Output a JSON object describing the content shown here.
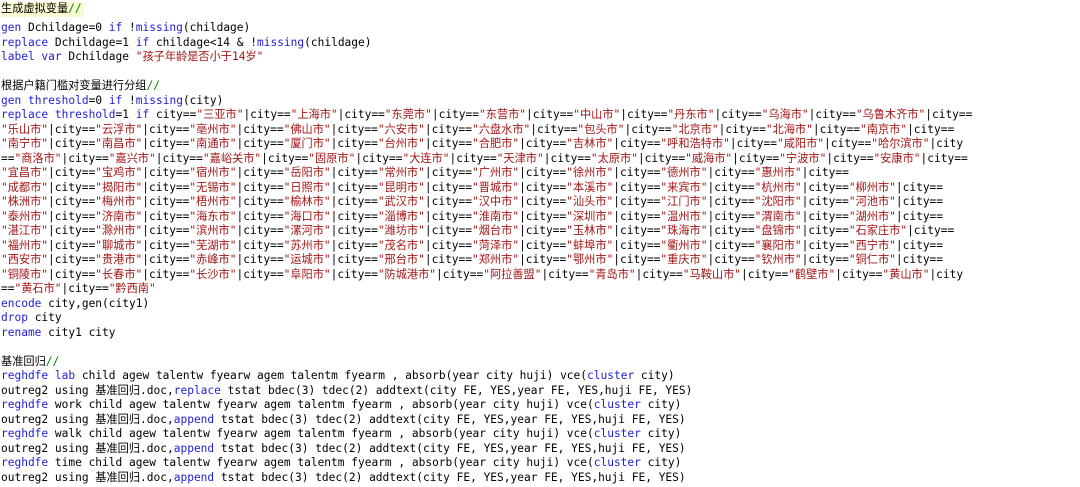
{
  "colors": {
    "keyword": "#1f1fd6",
    "string": "#a31515",
    "comment": "#008000",
    "text": "#000000",
    "current_line": "#fafad2"
  },
  "lines": [
    [
      {
        "t": "zh",
        "v": "生成虚拟变量"
      },
      {
        "t": "cmt",
        "v": "//"
      }
    ],
    [
      {
        "t": "kw",
        "v": "gen"
      },
      {
        "t": "n",
        "v": " Dchildage=0 "
      },
      {
        "t": "kw",
        "v": "if"
      },
      {
        "t": "n",
        "v": " !"
      },
      {
        "t": "kw",
        "v": "missing"
      },
      {
        "t": "n",
        "v": "(childage)"
      }
    ],
    [
      {
        "t": "kw",
        "v": "replace"
      },
      {
        "t": "n",
        "v": " Dchildage=1 "
      },
      {
        "t": "kw",
        "v": "if"
      },
      {
        "t": "n",
        "v": " childage<14 & !"
      },
      {
        "t": "kw",
        "v": "missing"
      },
      {
        "t": "n",
        "v": "(childage)"
      }
    ],
    [
      {
        "t": "kw",
        "v": "label var"
      },
      {
        "t": "n",
        "v": " Dchildage "
      },
      {
        "t": "str",
        "v": "\"孩子年龄是否小于14岁\""
      }
    ],
    [],
    [
      {
        "t": "zh",
        "v": "根据户籍门槛对变量进行分组"
      },
      {
        "t": "cmt",
        "v": "//"
      }
    ],
    [
      {
        "t": "kw",
        "v": "gen"
      },
      {
        "t": "n",
        "v": " "
      },
      {
        "t": "kw",
        "v": "threshold"
      },
      {
        "t": "n",
        "v": "=0 "
      },
      {
        "t": "kw",
        "v": "if"
      },
      {
        "t": "n",
        "v": " !"
      },
      {
        "t": "kw",
        "v": "missing"
      },
      {
        "t": "n",
        "v": "(city)"
      }
    ],
    [
      {
        "t": "kw",
        "v": "replace"
      },
      {
        "t": "n",
        "v": " "
      },
      {
        "t": "kw",
        "v": "threshold"
      },
      {
        "t": "n",
        "v": "=1 "
      },
      {
        "t": "kw",
        "v": "if"
      },
      {
        "t": "n",
        "v": " city=="
      },
      {
        "t": "str",
        "v": "\"三亚市\""
      },
      {
        "t": "n",
        "v": "|city=="
      },
      {
        "t": "str",
        "v": "\"上海市\""
      },
      {
        "t": "n",
        "v": "|city=="
      },
      {
        "t": "str",
        "v": "\"东莞市\""
      },
      {
        "t": "n",
        "v": "|city=="
      },
      {
        "t": "str",
        "v": "\"东营市\""
      },
      {
        "t": "n",
        "v": "|city=="
      },
      {
        "t": "str",
        "v": "\"中山市\""
      },
      {
        "t": "n",
        "v": "|city=="
      },
      {
        "t": "str",
        "v": "\"丹东市\""
      },
      {
        "t": "n",
        "v": "|city=="
      },
      {
        "t": "str",
        "v": "\"乌海市\""
      },
      {
        "t": "n",
        "v": "|city=="
      },
      {
        "t": "str",
        "v": "\"乌鲁木齐市\""
      },
      {
        "t": "n",
        "v": "|city=="
      }
    ],
    [
      {
        "t": "str",
        "v": "\"乐山市\""
      },
      {
        "t": "n",
        "v": "|city=="
      },
      {
        "t": "str",
        "v": "\"云浮市\""
      },
      {
        "t": "n",
        "v": "|city=="
      },
      {
        "t": "str",
        "v": "\"亳州市\""
      },
      {
        "t": "n",
        "v": "|city=="
      },
      {
        "t": "str",
        "v": "\"佛山市\""
      },
      {
        "t": "n",
        "v": "|city=="
      },
      {
        "t": "str",
        "v": "\"六安市\""
      },
      {
        "t": "n",
        "v": "|city=="
      },
      {
        "t": "str",
        "v": "\"六盘水市\""
      },
      {
        "t": "n",
        "v": "|city=="
      },
      {
        "t": "str",
        "v": "\"包头市\""
      },
      {
        "t": "n",
        "v": "|city=="
      },
      {
        "t": "str",
        "v": "\"北京市\""
      },
      {
        "t": "n",
        "v": "|city=="
      },
      {
        "t": "str",
        "v": "\"北海市\""
      },
      {
        "t": "n",
        "v": "|city=="
      },
      {
        "t": "str",
        "v": "\"南京市\""
      },
      {
        "t": "n",
        "v": "|city=="
      }
    ],
    [
      {
        "t": "str",
        "v": "\"南宁市\""
      },
      {
        "t": "n",
        "v": "|city=="
      },
      {
        "t": "str",
        "v": "\"南昌市\""
      },
      {
        "t": "n",
        "v": "|city=="
      },
      {
        "t": "str",
        "v": "\"南通市\""
      },
      {
        "t": "n",
        "v": "|city=="
      },
      {
        "t": "str",
        "v": "\"厦门市\""
      },
      {
        "t": "n",
        "v": "|city=="
      },
      {
        "t": "str",
        "v": "\"台州市\""
      },
      {
        "t": "n",
        "v": "|city=="
      },
      {
        "t": "str",
        "v": "\"合肥市\""
      },
      {
        "t": "n",
        "v": "|city=="
      },
      {
        "t": "str",
        "v": "\"吉林市\""
      },
      {
        "t": "n",
        "v": "|city=="
      },
      {
        "t": "str",
        "v": "\"呼和浩特市\""
      },
      {
        "t": "n",
        "v": "|city=="
      },
      {
        "t": "str",
        "v": "\"咸阳市\""
      },
      {
        "t": "n",
        "v": "|city=="
      },
      {
        "t": "str",
        "v": "\"哈尔滨市\""
      },
      {
        "t": "n",
        "v": "|city"
      }
    ],
    [
      {
        "t": "n",
        "v": "=="
      },
      {
        "t": "str",
        "v": "\"商洛市\""
      },
      {
        "t": "n",
        "v": "|city=="
      },
      {
        "t": "str",
        "v": "\"嘉兴市\""
      },
      {
        "t": "n",
        "v": "|city=="
      },
      {
        "t": "str",
        "v": "\"嘉峪关市\""
      },
      {
        "t": "n",
        "v": "|city=="
      },
      {
        "t": "str",
        "v": "\"固原市\""
      },
      {
        "t": "n",
        "v": "|city=="
      },
      {
        "t": "str",
        "v": "\"大连市\""
      },
      {
        "t": "n",
        "v": "|city=="
      },
      {
        "t": "str",
        "v": "\"天津市\""
      },
      {
        "t": "n",
        "v": "|city=="
      },
      {
        "t": "str",
        "v": "\"太原市\""
      },
      {
        "t": "n",
        "v": "|city=="
      },
      {
        "t": "str",
        "v": "\"威海市\""
      },
      {
        "t": "n",
        "v": "|city=="
      },
      {
        "t": "str",
        "v": "\"宁波市\""
      },
      {
        "t": "n",
        "v": "|city=="
      },
      {
        "t": "str",
        "v": "\"安康市\""
      },
      {
        "t": "n",
        "v": "|city=="
      }
    ],
    [
      {
        "t": "str",
        "v": "\"宜昌市\""
      },
      {
        "t": "n",
        "v": "|city=="
      },
      {
        "t": "str",
        "v": "\"宝鸡市\""
      },
      {
        "t": "n",
        "v": "|city=="
      },
      {
        "t": "str",
        "v": "\"宿州市\""
      },
      {
        "t": "n",
        "v": "|city=="
      },
      {
        "t": "str",
        "v": "\"岳阳市\""
      },
      {
        "t": "n",
        "v": "|city=="
      },
      {
        "t": "str",
        "v": "\"常州市\""
      },
      {
        "t": "n",
        "v": "|city=="
      },
      {
        "t": "str",
        "v": "\"广州市\""
      },
      {
        "t": "n",
        "v": "|city=="
      },
      {
        "t": "str",
        "v": "\"徐州市\""
      },
      {
        "t": "n",
        "v": "|city=="
      },
      {
        "t": "str",
        "v": "\"德州市\""
      },
      {
        "t": "n",
        "v": "|city=="
      },
      {
        "t": "str",
        "v": "\"惠州市\""
      },
      {
        "t": "n",
        "v": "|city=="
      }
    ],
    [
      {
        "t": "str",
        "v": "\"成都市\""
      },
      {
        "t": "n",
        "v": "|city=="
      },
      {
        "t": "str",
        "v": "\"揭阳市\""
      },
      {
        "t": "n",
        "v": "|city=="
      },
      {
        "t": "str",
        "v": "\"无锡市\""
      },
      {
        "t": "n",
        "v": "|city=="
      },
      {
        "t": "str",
        "v": "\"日照市\""
      },
      {
        "t": "n",
        "v": "|city=="
      },
      {
        "t": "str",
        "v": "\"昆明市\""
      },
      {
        "t": "n",
        "v": "|city=="
      },
      {
        "t": "str",
        "v": "\"晋城市\""
      },
      {
        "t": "n",
        "v": "|city=="
      },
      {
        "t": "str",
        "v": "\"本溪市\""
      },
      {
        "t": "n",
        "v": "|city=="
      },
      {
        "t": "str",
        "v": "\"来宾市\""
      },
      {
        "t": "n",
        "v": "|city=="
      },
      {
        "t": "str",
        "v": "\"杭州市\""
      },
      {
        "t": "n",
        "v": "|city=="
      },
      {
        "t": "str",
        "v": "\"柳州市\""
      },
      {
        "t": "n",
        "v": "|city=="
      }
    ],
    [
      {
        "t": "str",
        "v": "\"株洲市\""
      },
      {
        "t": "n",
        "v": "|city=="
      },
      {
        "t": "str",
        "v": "\"梅州市\""
      },
      {
        "t": "n",
        "v": "|city=="
      },
      {
        "t": "str",
        "v": "\"梧州市\""
      },
      {
        "t": "n",
        "v": "|city=="
      },
      {
        "t": "str",
        "v": "\"榆林市\""
      },
      {
        "t": "n",
        "v": "|city=="
      },
      {
        "t": "str",
        "v": "\"武汉市\""
      },
      {
        "t": "n",
        "v": "|city=="
      },
      {
        "t": "str",
        "v": "\"汉中市\""
      },
      {
        "t": "n",
        "v": "|city=="
      },
      {
        "t": "str",
        "v": "\"汕头市\""
      },
      {
        "t": "n",
        "v": "|city=="
      },
      {
        "t": "str",
        "v": "\"江门市\""
      },
      {
        "t": "n",
        "v": "|city=="
      },
      {
        "t": "str",
        "v": "\"沈阳市\""
      },
      {
        "t": "n",
        "v": "|city=="
      },
      {
        "t": "str",
        "v": "\"河池市\""
      },
      {
        "t": "n",
        "v": "|city=="
      }
    ],
    [
      {
        "t": "str",
        "v": "\"泰州市\""
      },
      {
        "t": "n",
        "v": "|city=="
      },
      {
        "t": "str",
        "v": "\"济南市\""
      },
      {
        "t": "n",
        "v": "|city=="
      },
      {
        "t": "str",
        "v": "\"海东市\""
      },
      {
        "t": "n",
        "v": "|city=="
      },
      {
        "t": "str",
        "v": "\"海口市\""
      },
      {
        "t": "n",
        "v": "|city=="
      },
      {
        "t": "str",
        "v": "\"淄博市\""
      },
      {
        "t": "n",
        "v": "|city=="
      },
      {
        "t": "str",
        "v": "\"淮南市\""
      },
      {
        "t": "n",
        "v": "|city=="
      },
      {
        "t": "str",
        "v": "\"深圳市\""
      },
      {
        "t": "n",
        "v": "|city=="
      },
      {
        "t": "str",
        "v": "\"温州市\""
      },
      {
        "t": "n",
        "v": "|city=="
      },
      {
        "t": "str",
        "v": "\"渭南市\""
      },
      {
        "t": "n",
        "v": "|city=="
      },
      {
        "t": "str",
        "v": "\"湖州市\""
      },
      {
        "t": "n",
        "v": "|city=="
      }
    ],
    [
      {
        "t": "str",
        "v": "\"湛江市\""
      },
      {
        "t": "n",
        "v": "|city=="
      },
      {
        "t": "str",
        "v": "\"滁州市\""
      },
      {
        "t": "n",
        "v": "|city=="
      },
      {
        "t": "str",
        "v": "\"滨州市\""
      },
      {
        "t": "n",
        "v": "|city=="
      },
      {
        "t": "str",
        "v": "\"漯河市\""
      },
      {
        "t": "n",
        "v": "|city=="
      },
      {
        "t": "str",
        "v": "\"潍坊市\""
      },
      {
        "t": "n",
        "v": "|city=="
      },
      {
        "t": "str",
        "v": "\"烟台市\""
      },
      {
        "t": "n",
        "v": "|city=="
      },
      {
        "t": "str",
        "v": "\"玉林市\""
      },
      {
        "t": "n",
        "v": "|city=="
      },
      {
        "t": "str",
        "v": "\"珠海市\""
      },
      {
        "t": "n",
        "v": "|city=="
      },
      {
        "t": "str",
        "v": "\"盘锦市\""
      },
      {
        "t": "n",
        "v": "|city=="
      },
      {
        "t": "str",
        "v": "\"石家庄市\""
      },
      {
        "t": "n",
        "v": "|city=="
      }
    ],
    [
      {
        "t": "str",
        "v": "\"福州市\""
      },
      {
        "t": "n",
        "v": "|city=="
      },
      {
        "t": "str",
        "v": "\"聊城市\""
      },
      {
        "t": "n",
        "v": "|city=="
      },
      {
        "t": "str",
        "v": "\"芜湖市\""
      },
      {
        "t": "n",
        "v": "|city=="
      },
      {
        "t": "str",
        "v": "\"苏州市\""
      },
      {
        "t": "n",
        "v": "|city=="
      },
      {
        "t": "str",
        "v": "\"茂名市\""
      },
      {
        "t": "n",
        "v": "|city=="
      },
      {
        "t": "str",
        "v": "\"菏泽市\""
      },
      {
        "t": "n",
        "v": "|city=="
      },
      {
        "t": "str",
        "v": "\"蚌埠市\""
      },
      {
        "t": "n",
        "v": "|city=="
      },
      {
        "t": "str",
        "v": "\"衢州市\""
      },
      {
        "t": "n",
        "v": "|city=="
      },
      {
        "t": "str",
        "v": "\"襄阳市\""
      },
      {
        "t": "n",
        "v": "|city=="
      },
      {
        "t": "str",
        "v": "\"西宁市\""
      },
      {
        "t": "n",
        "v": "|city=="
      }
    ],
    [
      {
        "t": "str",
        "v": "\"西安市\""
      },
      {
        "t": "n",
        "v": "|city=="
      },
      {
        "t": "str",
        "v": "\"贵港市\""
      },
      {
        "t": "n",
        "v": "|city=="
      },
      {
        "t": "str",
        "v": "\"赤峰市\""
      },
      {
        "t": "n",
        "v": "|city=="
      },
      {
        "t": "str",
        "v": "\"运城市\""
      },
      {
        "t": "n",
        "v": "|city=="
      },
      {
        "t": "str",
        "v": "\"邢台市\""
      },
      {
        "t": "n",
        "v": "|city=="
      },
      {
        "t": "str",
        "v": "\"郑州市\""
      },
      {
        "t": "n",
        "v": "|city=="
      },
      {
        "t": "str",
        "v": "\"鄂州市\""
      },
      {
        "t": "n",
        "v": "|city=="
      },
      {
        "t": "str",
        "v": "\"重庆市\""
      },
      {
        "t": "n",
        "v": "|city=="
      },
      {
        "t": "str",
        "v": "\"钦州市\""
      },
      {
        "t": "n",
        "v": "|city=="
      },
      {
        "t": "str",
        "v": "\"铜仁市\""
      },
      {
        "t": "n",
        "v": "|city=="
      }
    ],
    [
      {
        "t": "str",
        "v": "\"铜陵市\""
      },
      {
        "t": "n",
        "v": "|city=="
      },
      {
        "t": "str",
        "v": "\"长春市\""
      },
      {
        "t": "n",
        "v": "|city=="
      },
      {
        "t": "str",
        "v": "\"长沙市\""
      },
      {
        "t": "n",
        "v": "|city=="
      },
      {
        "t": "str",
        "v": "\"阜阳市\""
      },
      {
        "t": "n",
        "v": "|city=="
      },
      {
        "t": "str",
        "v": "\"防城港市\""
      },
      {
        "t": "n",
        "v": "|city=="
      },
      {
        "t": "str",
        "v": "\"阿拉善盟\""
      },
      {
        "t": "n",
        "v": "|city=="
      },
      {
        "t": "str",
        "v": "\"青岛市\""
      },
      {
        "t": "n",
        "v": "|city=="
      },
      {
        "t": "str",
        "v": "\"马鞍山市\""
      },
      {
        "t": "n",
        "v": "|city=="
      },
      {
        "t": "str",
        "v": "\"鹤壁市\""
      },
      {
        "t": "n",
        "v": "|city=="
      },
      {
        "t": "str",
        "v": "\"黄山市\""
      },
      {
        "t": "n",
        "v": "|city"
      }
    ],
    [
      {
        "t": "n",
        "v": "=="
      },
      {
        "t": "str",
        "v": "\"黄石市\""
      },
      {
        "t": "n",
        "v": "|city=="
      },
      {
        "t": "str",
        "v": "\"黔西南\""
      }
    ],
    [
      {
        "t": "kw",
        "v": "encode"
      },
      {
        "t": "n",
        "v": " city,gen(city1)"
      }
    ],
    [
      {
        "t": "kw",
        "v": "drop"
      },
      {
        "t": "n",
        "v": " city"
      }
    ],
    [
      {
        "t": "kw",
        "v": "rename"
      },
      {
        "t": "n",
        "v": " city1 city"
      }
    ],
    [],
    [
      {
        "t": "zh",
        "v": "基准回归"
      },
      {
        "t": "cmt",
        "v": "//"
      }
    ],
    [
      {
        "t": "kw",
        "v": "reghdfe"
      },
      {
        "t": "n",
        "v": " "
      },
      {
        "t": "kw",
        "v": "lab"
      },
      {
        "t": "n",
        "v": " child agew talentw fyearw agem talentm fyearm , absorb(year city huji) vce("
      },
      {
        "t": "kw",
        "v": "cluster"
      },
      {
        "t": "n",
        "v": " city)"
      }
    ],
    [
      {
        "t": "n",
        "v": "outreg2 using 基准回归.doc,"
      },
      {
        "t": "kw",
        "v": "replace"
      },
      {
        "t": "n",
        "v": " tstat bdec(3) tdec(2) addtext(city FE, YES,year FE, YES,huji FE, YES)"
      }
    ],
    [
      {
        "t": "kw",
        "v": "reghdfe"
      },
      {
        "t": "n",
        "v": " work child agew talentw fyearw agem talentm fyearm , absorb(year city huji) vce("
      },
      {
        "t": "kw",
        "v": "cluster"
      },
      {
        "t": "n",
        "v": " city)"
      }
    ],
    [
      {
        "t": "n",
        "v": "outreg2 using 基准回归.doc,"
      },
      {
        "t": "kw",
        "v": "append"
      },
      {
        "t": "n",
        "v": " tstat bdec(3) tdec(2) addtext(city FE, YES,year FE, YES,huji FE, YES)"
      }
    ],
    [
      {
        "t": "kw",
        "v": "reghdfe"
      },
      {
        "t": "n",
        "v": " walk child agew talentw fyearw agem talentm fyearm , absorb(year city huji) vce("
      },
      {
        "t": "kw",
        "v": "cluster"
      },
      {
        "t": "n",
        "v": " city)"
      }
    ],
    [
      {
        "t": "n",
        "v": "outreg2 using 基准回归.doc,"
      },
      {
        "t": "kw",
        "v": "append"
      },
      {
        "t": "n",
        "v": " tstat bdec(3) tdec(2) addtext(city FE, YES,year FE, YES,huji FE, YES)"
      }
    ],
    [
      {
        "t": "kw",
        "v": "reghdfe"
      },
      {
        "t": "n",
        "v": " time child agew talentw fyearw agem talentm fyearm , absorb(year city huji) vce("
      },
      {
        "t": "kw",
        "v": "cluster"
      },
      {
        "t": "n",
        "v": " city)"
      }
    ],
    [
      {
        "t": "n",
        "v": "outreg2 using 基准回归.doc,"
      },
      {
        "t": "kw",
        "v": "append"
      },
      {
        "t": "n",
        "v": " tstat bdec(3) tdec(2) addtext(city FE, YES,year FE, YES,huji FE, YES)"
      }
    ]
  ]
}
